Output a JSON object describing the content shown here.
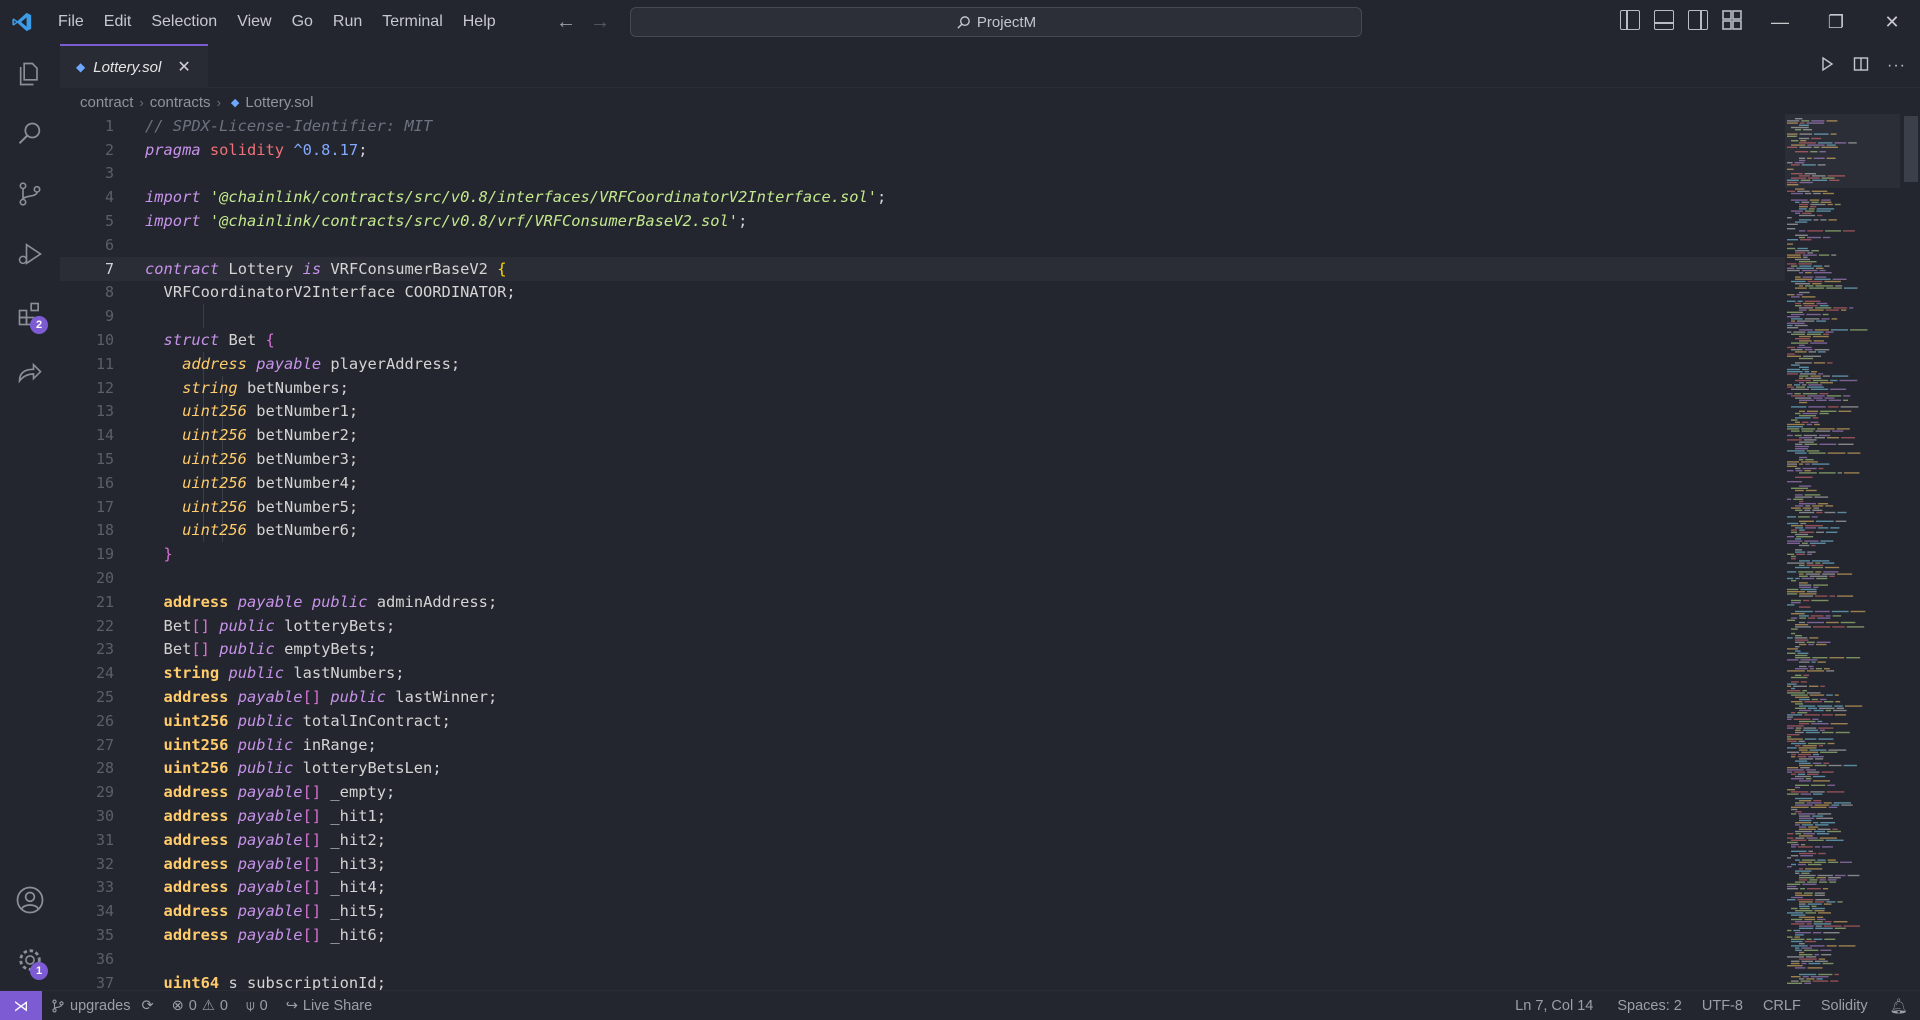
{
  "menu": [
    "File",
    "Edit",
    "Selection",
    "View",
    "Go",
    "Run",
    "Terminal",
    "Help"
  ],
  "search": {
    "text": "ProjectM"
  },
  "activity": {
    "extensions_badge": "2",
    "settings_badge": "1"
  },
  "tab": {
    "label": "Lottery.sol"
  },
  "breadcrumb": {
    "part1": "contract",
    "part2": "contracts",
    "file": "Lottery.sol"
  },
  "editor": {
    "current_line": 7,
    "lines": [
      "// SPDX-License-Identifier: MIT",
      "pragma solidity ^0.8.17;",
      "",
      "import '@chainlink/contracts/src/v0.8/interfaces/VRFCoordinatorV2Interface.sol';",
      "import '@chainlink/contracts/src/v0.8/vrf/VRFConsumerBaseV2.sol';",
      "",
      "contract Lottery is VRFConsumerBaseV2 {",
      "  VRFCoordinatorV2Interface COORDINATOR;",
      "",
      "  struct Bet {",
      "    address payable playerAddress;",
      "    string betNumbers;",
      "    uint256 betNumber1;",
      "    uint256 betNumber2;",
      "    uint256 betNumber3;",
      "    uint256 betNumber4;",
      "    uint256 betNumber5;",
      "    uint256 betNumber6;",
      "  }",
      "",
      "  address payable public adminAddress;",
      "  Bet[] public lotteryBets;",
      "  Bet[] public emptyBets;",
      "  string public lastNumbers;",
      "  address payable[] public lastWinner;",
      "  uint256 public totalInContract;",
      "  uint256 public inRange;",
      "  uint256 public lotteryBetsLen;",
      "  address payable[] _empty;",
      "  address payable[] _hit1;",
      "  address payable[] _hit2;",
      "  address payable[] _hit3;",
      "  address payable[] _hit4;",
      "  address payable[] _hit5;",
      "  address payable[] _hit6;",
      "",
      "  uint64 s_subscriptionId;"
    ]
  },
  "status": {
    "branch": "upgrades",
    "errors": "0",
    "warnings": "0",
    "ports": "0",
    "live_share": "Live Share",
    "position": "Ln 7, Col 14",
    "spaces": "Spaces: 2",
    "encoding": "UTF-8",
    "eol": "CRLF",
    "language": "Solidity"
  },
  "colors": {
    "accent": "#7d5bd3",
    "background": "#23262e"
  }
}
